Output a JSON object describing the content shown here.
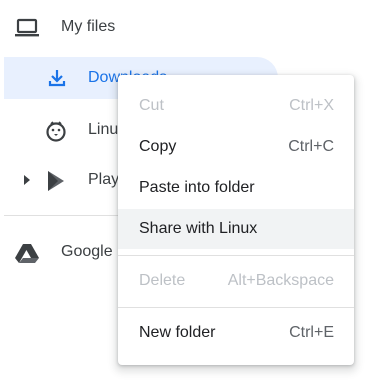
{
  "nav": {
    "my_files": {
      "label": "My files",
      "icon": "laptop-icon"
    },
    "downloads": {
      "label": "Downloads",
      "icon": "download-icon",
      "selected": true
    },
    "linux": {
      "label": "Linux files",
      "icon": "penguin-icon"
    },
    "play": {
      "label": "Play files",
      "icon": "play-store-icon"
    },
    "google_drive": {
      "label": "Google Drive",
      "icon": "google-drive-icon"
    }
  },
  "context_menu": {
    "items": [
      {
        "label": "Cut",
        "shortcut": "Ctrl+X",
        "enabled": false
      },
      {
        "label": "Copy",
        "shortcut": "Ctrl+C",
        "enabled": true
      },
      {
        "label": "Paste into folder",
        "shortcut": "",
        "enabled": true
      },
      {
        "label": "Share with Linux",
        "shortcut": "",
        "enabled": true,
        "hovered": true
      },
      {
        "label": "Delete",
        "shortcut": "Alt+Backspace",
        "enabled": false
      },
      {
        "label": "New folder",
        "shortcut": "Ctrl+E",
        "enabled": true
      }
    ]
  },
  "colors": {
    "accent": "#1a73e8",
    "selected_bg": "#e8f0fe",
    "text": "#3c4043",
    "disabled_text": "#bdc1c6",
    "hover_bg": "#f1f3f4"
  }
}
